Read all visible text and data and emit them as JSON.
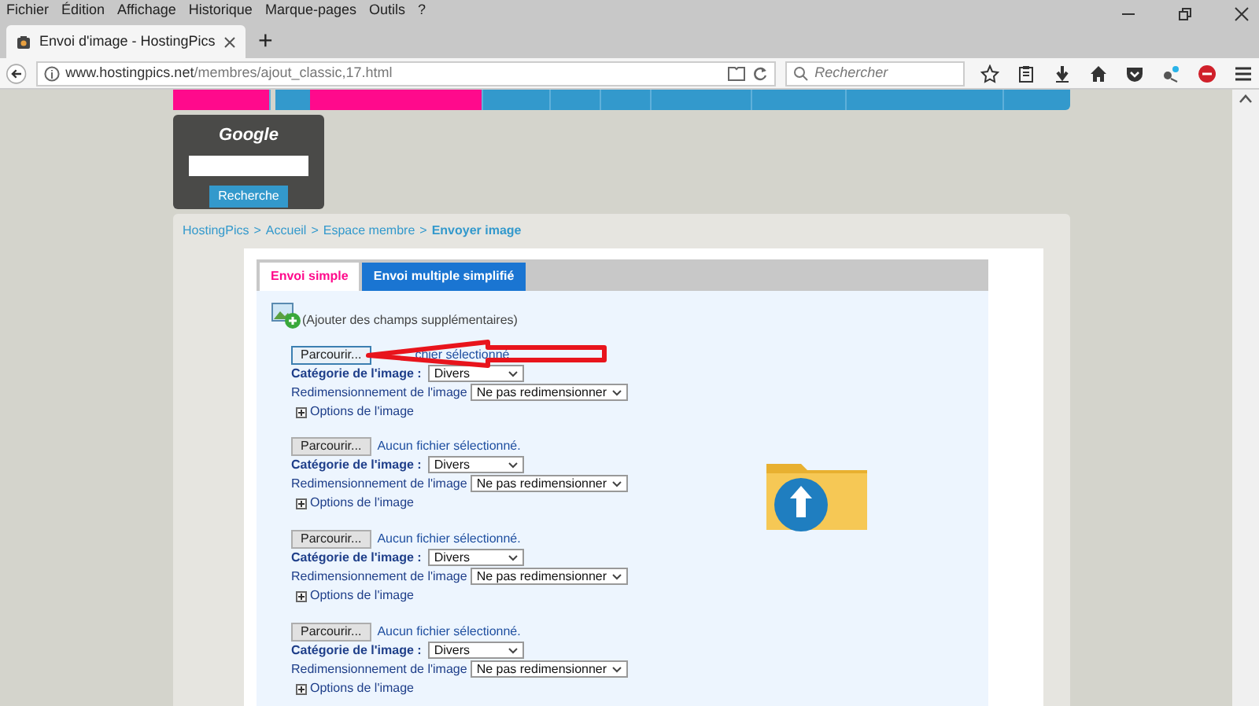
{
  "menu_bar": [
    "Fichier",
    "Édition",
    "Affichage",
    "Historique",
    "Marque-pages",
    "Outils",
    "?"
  ],
  "browser_tab": {
    "title": "Envoi d'image - HostingPics",
    "selected": true
  },
  "new_tab": "+",
  "address": {
    "host": "www.hostingpics.net",
    "path": "/membres/ajout_classic,17.html"
  },
  "browser_search": {
    "placeholder": "Rechercher"
  },
  "site_nav": [
    {
      "highlighted": true
    },
    {
      "highlighted": false
    },
    {
      "highlighted": true
    },
    {
      "highlighted": false
    },
    {
      "highlighted": false
    },
    {
      "highlighted": false
    },
    {
      "highlighted": false
    },
    {
      "highlighted": false
    },
    {
      "highlighted": false
    }
  ],
  "google_box": {
    "title": "Google",
    "button": "Recherche"
  },
  "breadcrumb": {
    "separator": ">",
    "items": [
      "HostingPics",
      "Accueil",
      "Espace membre",
      "Envoyer image"
    ]
  },
  "upload_tabs": [
    {
      "label": "Envoi simple",
      "selected": true
    },
    {
      "label": "Envoi multiple simplifié",
      "selected": false
    }
  ],
  "add_fields": "(Ajouter des champs supplémentaires)",
  "file_rows": [
    {
      "button": "Parcourir...",
      "file_status": "chier sélectionné",
      "category_label": "Catégorie de l'image :",
      "category": "Divers",
      "resize_label": "Redimensionnement de l'image",
      "resize": "Ne pas redimensionner",
      "options": "Options de l'image",
      "highlighted": true
    },
    {
      "button": "Parcourir...",
      "file_status": "Aucun fichier sélectionné.",
      "category_label": "Catégorie de l'image :",
      "category": "Divers",
      "resize_label": "Redimensionnement de l'image",
      "resize": "Ne pas redimensionner",
      "options": "Options de l'image",
      "highlighted": false
    },
    {
      "button": "Parcourir...",
      "file_status": "Aucun fichier sélectionné.",
      "category_label": "Catégorie de l'image :",
      "category": "Divers",
      "resize_label": "Redimensionnement de l'image",
      "resize": "Ne pas redimensionner",
      "options": "Options de l'image",
      "highlighted": false
    },
    {
      "button": "Parcourir...",
      "file_status": "Aucun fichier sélectionné.",
      "category_label": "Catégorie de l'image :",
      "category": "Divers",
      "resize_label": "Redimensionnement de l'image",
      "resize": "Ne pas redimensionner",
      "options": "Options de l'image",
      "highlighted": false
    }
  ]
}
